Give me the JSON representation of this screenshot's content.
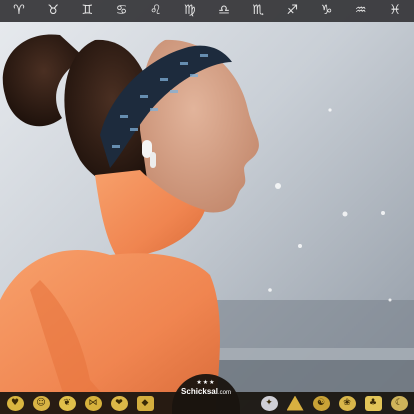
{
  "zodiac_bar": {
    "items": [
      {
        "name": "aries",
        "glyph": "♈︎"
      },
      {
        "name": "taurus",
        "glyph": "♉︎"
      },
      {
        "name": "gemini",
        "glyph": "♊︎"
      },
      {
        "name": "cancer",
        "glyph": "♋︎"
      },
      {
        "name": "leo",
        "glyph": "♌︎"
      },
      {
        "name": "virgo",
        "glyph": "♍︎"
      },
      {
        "name": "libra",
        "glyph": "♎︎"
      },
      {
        "name": "scorpio",
        "glyph": "♏︎"
      },
      {
        "name": "sagittarius",
        "glyph": "♐︎"
      },
      {
        "name": "capricorn",
        "glyph": "♑︎"
      },
      {
        "name": "aquarius",
        "glyph": "♒︎"
      },
      {
        "name": "pisces",
        "glyph": "♓︎"
      }
    ]
  },
  "category_bar": {
    "left_items": [
      {
        "name": "love-heart-icon",
        "glyph": "♥",
        "color": "#d9b640",
        "shape": "circle"
      },
      {
        "name": "mask-icon",
        "glyph": "☺",
        "color": "#d8b444",
        "shape": "circle"
      },
      {
        "name": "butterfly-icon",
        "glyph": "❦",
        "color": "#e0c04a",
        "shape": "circle"
      },
      {
        "name": "bow-tie-icon",
        "glyph": "⋈",
        "color": "#d7b23c",
        "shape": "circle"
      },
      {
        "name": "heart-gem-icon",
        "glyph": "❤",
        "color": "#dcb848",
        "shape": "circle"
      },
      {
        "name": "shield-icon",
        "glyph": "◆",
        "color": "#d4ae3e",
        "shape": "sq"
      }
    ],
    "right_items": [
      {
        "name": "compass-icon",
        "glyph": "✦",
        "color": "#cfcfd6",
        "shape": "circle"
      },
      {
        "name": "crystal-pyramid-icon",
        "glyph": "",
        "color": "#d8b040",
        "shape": "tri"
      },
      {
        "name": "chinese-zodiac-icon",
        "glyph": "☯",
        "color": "#c9a236",
        "shape": "circle"
      },
      {
        "name": "wheat-icon",
        "glyph": "❀",
        "color": "#d9b74a",
        "shape": "circle"
      },
      {
        "name": "clover-icon",
        "glyph": "♣",
        "color": "#e2c558",
        "shape": "sq"
      },
      {
        "name": "moon-icon",
        "glyph": "☾",
        "color": "#cfb45a",
        "shape": "circle"
      }
    ]
  },
  "logo": {
    "stars": "★★★",
    "brand": "Schicksal",
    "suffix": ".com"
  }
}
